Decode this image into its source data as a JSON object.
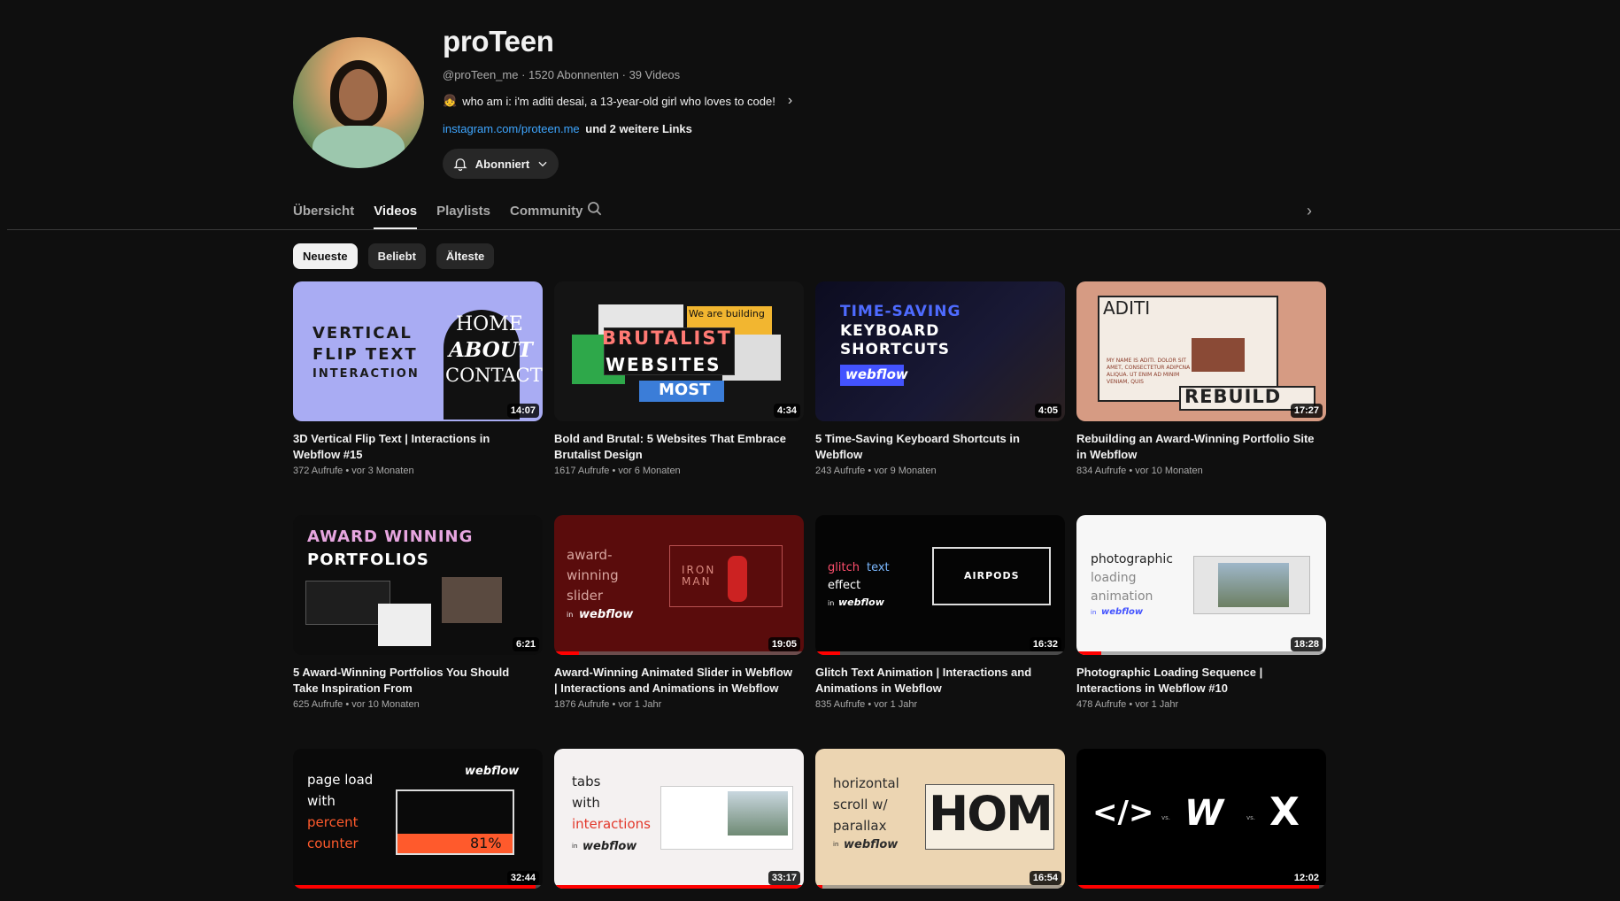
{
  "channel": {
    "name": "proTeen",
    "handle": "@proTeen_me",
    "subscribers": "1520 Abonnenten",
    "videos_count": "39 Videos",
    "description_emoji": "👧",
    "description": "who am i: i'm aditi desai, a 13-year-old girl who loves to code!",
    "link": "instagram.com/proteen.me",
    "more_links": "und 2 weitere Links",
    "subscribe_label": "Abonniert"
  },
  "tabs": [
    {
      "label": "Übersicht",
      "active": false
    },
    {
      "label": "Videos",
      "active": true
    },
    {
      "label": "Playlists",
      "active": false
    },
    {
      "label": "Community",
      "active": false
    }
  ],
  "chips": [
    {
      "label": "Neueste",
      "active": true
    },
    {
      "label": "Beliebt",
      "active": false
    },
    {
      "label": "Älteste",
      "active": false
    }
  ],
  "videos": [
    {
      "title": "3D Vertical Flip Text | Interactions in Webflow #15",
      "views": "372 Aufrufe",
      "age": "vor 3 Monaten",
      "duration": "14:07",
      "watched": 0
    },
    {
      "title": "Bold and Brutal: 5 Websites That Embrace Brutalist Design",
      "views": "1617 Aufrufe",
      "age": "vor 6 Monaten",
      "duration": "4:34",
      "watched": 0
    },
    {
      "title": "5 Time-Saving Keyboard Shortcuts in Webflow",
      "views": "243 Aufrufe",
      "age": "vor 9 Monaten",
      "duration": "4:05",
      "watched": 0
    },
    {
      "title": "Rebuilding an Award-Winning Portfolio Site in Webflow",
      "views": "834 Aufrufe",
      "age": "vor 10 Monaten",
      "duration": "17:27",
      "watched": 0
    },
    {
      "title": "5 Award-Winning Portfolios You Should Take Inspiration From",
      "views": "625 Aufrufe",
      "age": "vor 10 Monaten",
      "duration": "6:21",
      "watched": 0
    },
    {
      "title": "Award-Winning Animated Slider in Webflow | Interactions and Animations in Webflow",
      "views": "1876 Aufrufe",
      "age": "vor 1 Jahr",
      "duration": "19:05",
      "watched": 0.1
    },
    {
      "title": "Glitch Text Animation | Interactions and Animations in Webflow",
      "views": "835 Aufrufe",
      "age": "vor 1 Jahr",
      "duration": "16:32",
      "watched": 0.1
    },
    {
      "title": "Photographic Loading Sequence | Interactions in Webflow #10",
      "views": "478 Aufrufe",
      "age": "vor 1 Jahr",
      "duration": "18:28",
      "watched": 0.1
    },
    {
      "title": "",
      "views": "",
      "age": "",
      "duration": "32:44",
      "watched": 0.97
    },
    {
      "title": "",
      "views": "",
      "age": "",
      "duration": "33:17",
      "watched": 1.0
    },
    {
      "title": "",
      "views": "",
      "age": "",
      "duration": "16:54",
      "watched": 0.03
    },
    {
      "title": "",
      "views": "",
      "age": "",
      "duration": "12:02",
      "watched": 0.97
    }
  ],
  "thumb_text": {
    "t1": {
      "l1": "VERTICAL",
      "l2": "FLIP TEXT",
      "l3": "INTERACTION",
      "r1": "HOME",
      "r2": "ABOUT",
      "r3": "CONTACT"
    },
    "t2": {
      "l1": "BRUTALIST",
      "l2": "WEBSITES",
      "l3": "We are building",
      "l4": "MOST"
    },
    "t3": {
      "l1": "TIME-SAVING",
      "l2": "KEYBOARD",
      "l3": "SHORTCUTS",
      "l4": "webflow"
    },
    "t4": {
      "l1": "ADITI",
      "l2": "REBUILD",
      "l3": "MY NAME IS ADITI. DOLOR SIT AMET, CONSECTETUR ADIPCNA ALIQUA. UT ENIM AD MINIM VENIAM, QUIS"
    },
    "t5": {
      "l1": "AWARD WINNING",
      "l2": "PORTFOLIOS"
    },
    "t6": {
      "l1": "award-",
      "l2": "winning",
      "l3": "slider",
      "l4": "webflow",
      "l5": "IRON MAN",
      "in": "in"
    },
    "t7": {
      "l1": "glitch",
      "l2": "text",
      "l3": "effect",
      "l4": "webflow",
      "l5": "AIRPODS",
      "in": "in"
    },
    "t8": {
      "l1": "photographic",
      "l2": "loading",
      "l3": "animation",
      "l4": "webflow",
      "in": "in"
    },
    "t9": {
      "l1": "page load",
      "l2": "with",
      "l3": "percent",
      "l4": "counter",
      "l5": "webflow",
      "l6": "81%"
    },
    "t10": {
      "l1": "tabs",
      "l2": "with",
      "l3": "interactions",
      "l4": "webflow",
      "in": "in"
    },
    "t11": {
      "l1": "horizontal",
      "l2": "scroll w/",
      "l3": "parallax",
      "l4": "webflow",
      "l5": "HOM",
      "in": "in"
    },
    "t12": {
      "l1": "</>",
      "l2": "vs.",
      "l3": "W",
      "l4": "vs.",
      "l5": "X"
    }
  },
  "colors": {
    "background": "#0f0f0f",
    "link": "#3ea6ff",
    "progress": "#ff0000",
    "accent_orange": "#ff5a2c"
  }
}
